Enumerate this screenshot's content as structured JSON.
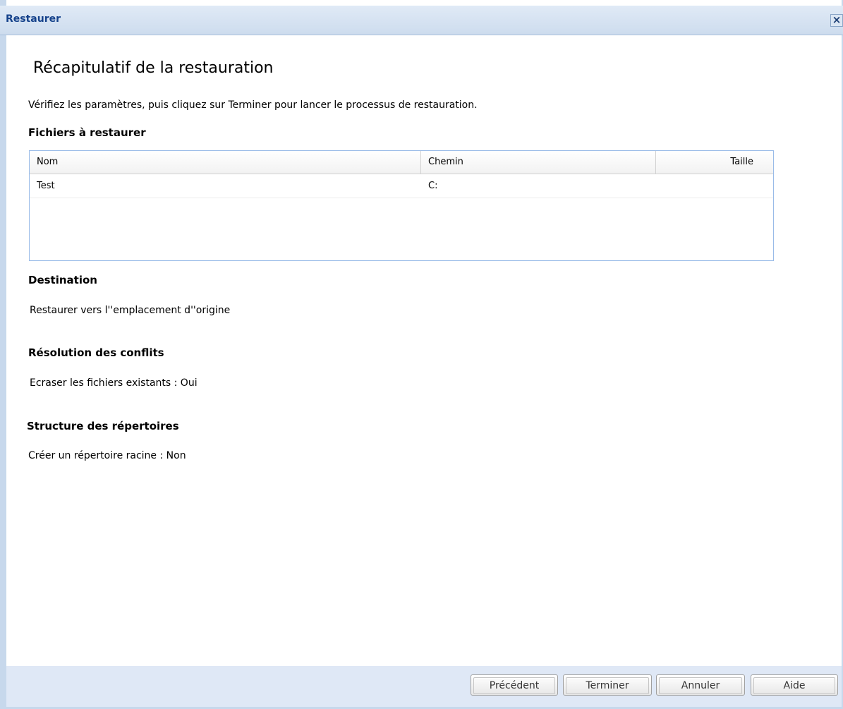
{
  "window": {
    "title": "Restaurer",
    "close_icon": "close-icon"
  },
  "page": {
    "title": "Récapitulatif de la restauration",
    "instructions": "Vérifiez les paramètres, puis cliquez sur Terminer pour lancer le processus de restauration."
  },
  "files": {
    "heading": "Fichiers à restaurer",
    "columns": [
      "Nom",
      "Chemin",
      "Taille"
    ],
    "rows": [
      {
        "name": "Test",
        "path": "C:",
        "size": ""
      }
    ]
  },
  "destination": {
    "heading": "Destination",
    "value": "Restaurer vers l''emplacement d''origine"
  },
  "conflicts": {
    "heading": "Résolution des conflits",
    "value": "Ecraser les fichiers existants : Oui"
  },
  "structure": {
    "heading": "Structure des répertoires",
    "value": "Créer un répertoire racine : Non"
  },
  "buttons": {
    "previous": "Précédent",
    "finish": "Terminer",
    "cancel": "Annuler",
    "help": "Aide"
  },
  "colors": {
    "title_text": "#15428b",
    "frame": "#c7d8ec",
    "footer": "#dfe8f6",
    "table_border": "#99bbe8"
  }
}
